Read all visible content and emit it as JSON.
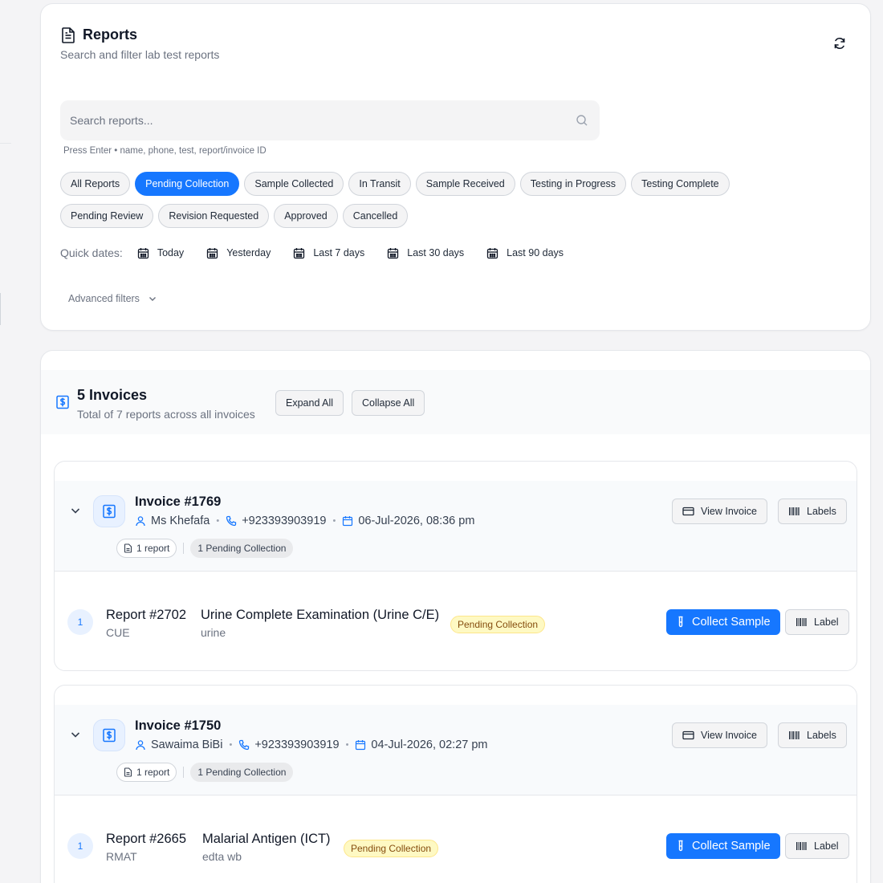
{
  "reports": {
    "title": "Reports",
    "subtitle": "Search and filter lab test reports",
    "search_placeholder": "Search reports...",
    "search_hint": "Press Enter • name, phone, test, report/invoice ID",
    "filters_row1": [
      "All Reports",
      "Pending Collection",
      "Sample Collected",
      "In Transit",
      "Sample Received",
      "Testing in Progress",
      "Testing Complete"
    ],
    "filters_row2": [
      "Pending Review",
      "Revision Requested",
      "Approved",
      "Cancelled"
    ],
    "active_filter": "Pending Collection",
    "quick_dates_label": "Quick dates:",
    "quick_dates": [
      "Today",
      "Yesterday",
      "Last 7 days",
      "Last 30 days",
      "Last 90 days"
    ],
    "advanced_filters": "Advanced filters"
  },
  "invoices": {
    "count_label": "5 Invoices",
    "total_label": "Total of 7 reports across all invoices",
    "expand_all": "Expand All",
    "collapse_all": "Collapse All",
    "view_invoice": "View Invoice",
    "labels": "Labels",
    "collect_sample": "Collect Sample",
    "label": "Label",
    "items": [
      {
        "title": "Invoice #1769",
        "patient": "Ms Khefafa",
        "phone": "+923393903919",
        "date": "06-Jul-2026, 08:36 pm",
        "report_count": "1 report",
        "status_summary": "1 Pending Collection",
        "report": {
          "index": "1",
          "title": "Report #2702",
          "code": "CUE",
          "test": "Urine Complete Examination (Urine C/E)",
          "sample": "urine",
          "status": "Pending Collection"
        }
      },
      {
        "title": "Invoice #1750",
        "patient": "Sawaima BiBi",
        "phone": "+923393903919",
        "date": "04-Jul-2026, 02:27 pm",
        "report_count": "1 report",
        "status_summary": "1 Pending Collection",
        "report": {
          "index": "1",
          "title": "Report #2665",
          "code": "RMAT",
          "test": "Malarial Antigen (ICT)",
          "sample": "edta wb",
          "status": "Pending Collection"
        }
      }
    ]
  },
  "colors": {
    "accent": "#1677ff",
    "pending_bg": "#fef9c3",
    "pending_text": "#854d0e"
  }
}
